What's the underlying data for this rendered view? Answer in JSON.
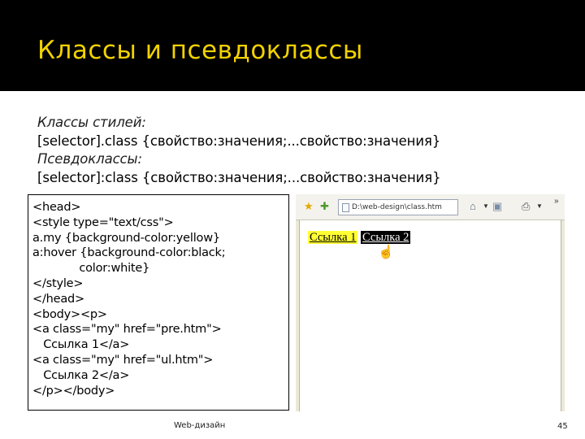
{
  "slide": {
    "title": "Классы и псевдоклассы",
    "title_color": "#f2d200",
    "header_bg": "#000000"
  },
  "syntax": [
    {
      "text": "Классы стилей:",
      "italic": true
    },
    {
      "text": "[selector].class {свойство:значения;...свойство:значения}",
      "italic": false
    },
    {
      "text": "Псевдоклассы:",
      "italic": true
    },
    {
      "text": "[selector]:class {свойство:значения;...свойство:значения}",
      "italic": false
    }
  ],
  "code": [
    "<head>",
    "<style type=\"text/css\">",
    "a.my {background-color:yellow}",
    "a:hover {background-color:black;",
    "             color:white}",
    "</style>",
    "</head>",
    "<body><p>",
    "<a class=\"my\" href=\"pre.htm\">",
    "   Ссылка 1</a>",
    "<a class=\"my\" href=\"ul.htm\">",
    "   Ссылка 2</a>",
    "</p></body>"
  ],
  "browser": {
    "address": "D:\\web-design\\class.htm",
    "icons": [
      "favorites-star-icon",
      "add-favorites-icon",
      "page-icon",
      "home-icon",
      "feeds-icon",
      "print-icon",
      "toolbar-overflow-icon"
    ],
    "link1": "Ссылка 1",
    "link2": "Ссылка 2",
    "link1_bg": "#ffff33",
    "link2_bg": "#000000"
  },
  "footer": {
    "caption": "Web-дизайн",
    "page_number": "45"
  }
}
